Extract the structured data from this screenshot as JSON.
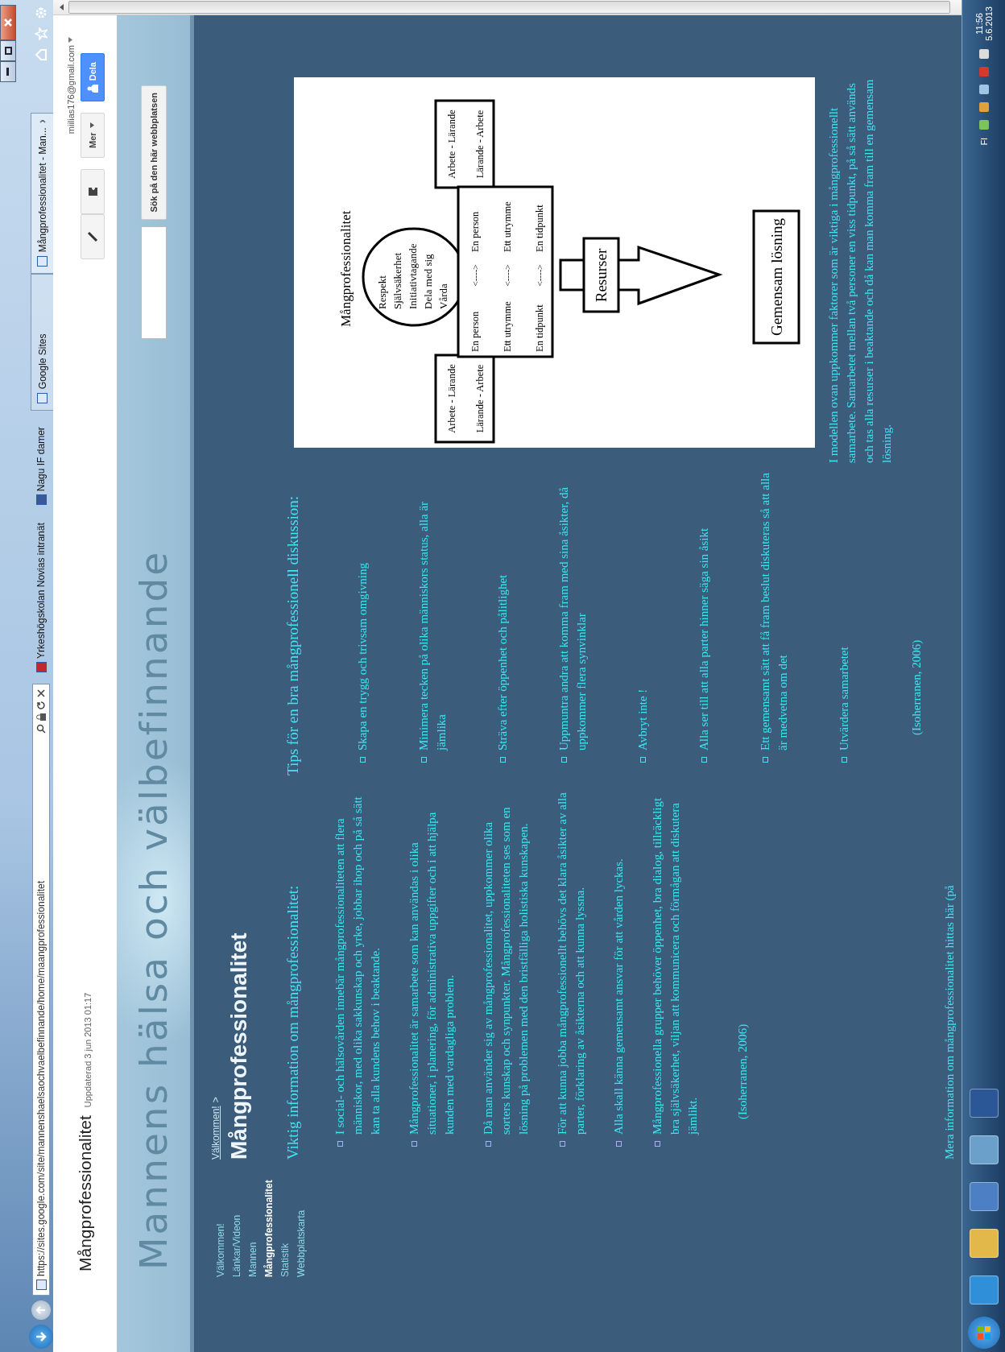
{
  "browser": {
    "url": "https://sites.google.com/site/mannenshaelsaochvaelbefinnande/home/maangprofessionalitet",
    "favorites": [
      "Yrkeshögskolan Novias intranät",
      "Nagu IF damer"
    ],
    "tabs": [
      {
        "label": "Google Sites",
        "selected": false
      },
      {
        "label": "Mångprofessionalitet - Man...",
        "selected": true
      }
    ]
  },
  "site_header": {
    "title": "Mångprofessionalitet",
    "updated": "Uppdaterad 3 jun 2013 01:17",
    "account": "miilias176@gmail.com",
    "more_button": "Mer",
    "share_button": "Dela"
  },
  "banner": {
    "title": "Mannens hälsa och välbefinnande",
    "search_button": "Sök på den här webbplatsen"
  },
  "sidebar": {
    "items": [
      {
        "label": "Välkommen!",
        "selected": false
      },
      {
        "label": "Länkar/Videon",
        "selected": false
      },
      {
        "label": "Mannen",
        "selected": false
      },
      {
        "label": "Mångprofessionalitet",
        "selected": true
      },
      {
        "label": "Statistik",
        "selected": false
      },
      {
        "label": "Webbplatskarta",
        "selected": false
      }
    ]
  },
  "page": {
    "breadcrumb": "Välkommen!",
    "breadcrumb_separator": ">",
    "title": "Mångprofessionalitet",
    "columns": [
      {
        "heading": "Viktig information om mångprofessionalitet:",
        "items": [
          "I social- och hälsovården innebär mångprofessionaliteten att flera människor, med olika sakkunskap och yrke, jobbar ihop och på så sätt kan ta alla kundens behov i beaktande.",
          "Mångprofessionalitet är samarbete som kan användas i olika situationer, i planering, för administrativa uppgifter och i att hjälpa kunden med vardagliga problem.",
          "Då man använder sig av mångprofessionalitet, uppkommer olika sorters kunskap och synpunkter. Mångprofessionaliteten ses som en lösning på problemen med den bristfälliga holistiska kunskapen.",
          "För att kunna jobba mångprofessionellt behövs det klara åsikter av alla parter, förklaring av åsikterna och att kunna lyssna.",
          "Alla skall känna gemensamt ansvar för att vården lyckas.",
          "Mångprofessionella grupper behöver öppenhet, bra dialog, tillräckligt bra självsäkerhet, viljan att kommunicera och förmågan att diskutera jämlikt."
        ],
        "citation": "(Isoherranen, 2006)",
        "more": "Mera information om mångprofessionalitet hittas här (på"
      },
      {
        "heading": "Tips för en bra mångprofessionell diskussion:",
        "items": [
          "Skapa en trygg och trivsam omgivning",
          "Minimera tecken på olika människors status, alla är jämlika",
          "Sträva efter öppenhet och pålitlighet",
          "Uppmuntra andra att komma fram med sina åsikter, då uppkommer flera synvinklar",
          "Avbryt inte !",
          "Alla ser till att alla parter hinner säga sin åsikt",
          "Ett gemensamt sätt att få fram beslut diskuteras så att alla är medvetna om det",
          "Utvärdera samarbetet"
        ],
        "citation": "(Isoherranen, 2006)"
      }
    ]
  },
  "diagram": {
    "title": "Mångprofessionalitet",
    "values": [
      "Respekt",
      "Självsäkerhet",
      "Initiativtagande",
      "Dela med sig",
      "Vårda"
    ],
    "side_boxes": [
      [
        "Arbete - Lärande",
        "Lärande - Arbete"
      ],
      [
        "Arbete - Lärande",
        "Lärande - Arbete"
      ]
    ],
    "pairs": [
      {
        "left": "En person",
        "arrow": "<---->",
        "right": "En person"
      },
      {
        "left": "Ett utrymme",
        "arrow": "<---->",
        "right": "Ett utrymme"
      },
      {
        "left": "En tidpunkt",
        "arrow": "<---->",
        "right": "En tidpunkt"
      }
    ],
    "resources": "Resurser",
    "solution": "Gemensam lösning"
  },
  "caption": "I modellen ovan uppkommer faktorer som är viktiga i mångprofessionellt samarbete. Samarbetet mellan två personer en viss tidpunkt, på så sätt används och tas alla resurser i beaktande och då kan man komma fram till en gemensam lösning.",
  "taskbar": {
    "language": "FI",
    "time": "11:56",
    "date": "5.6.2013"
  }
}
